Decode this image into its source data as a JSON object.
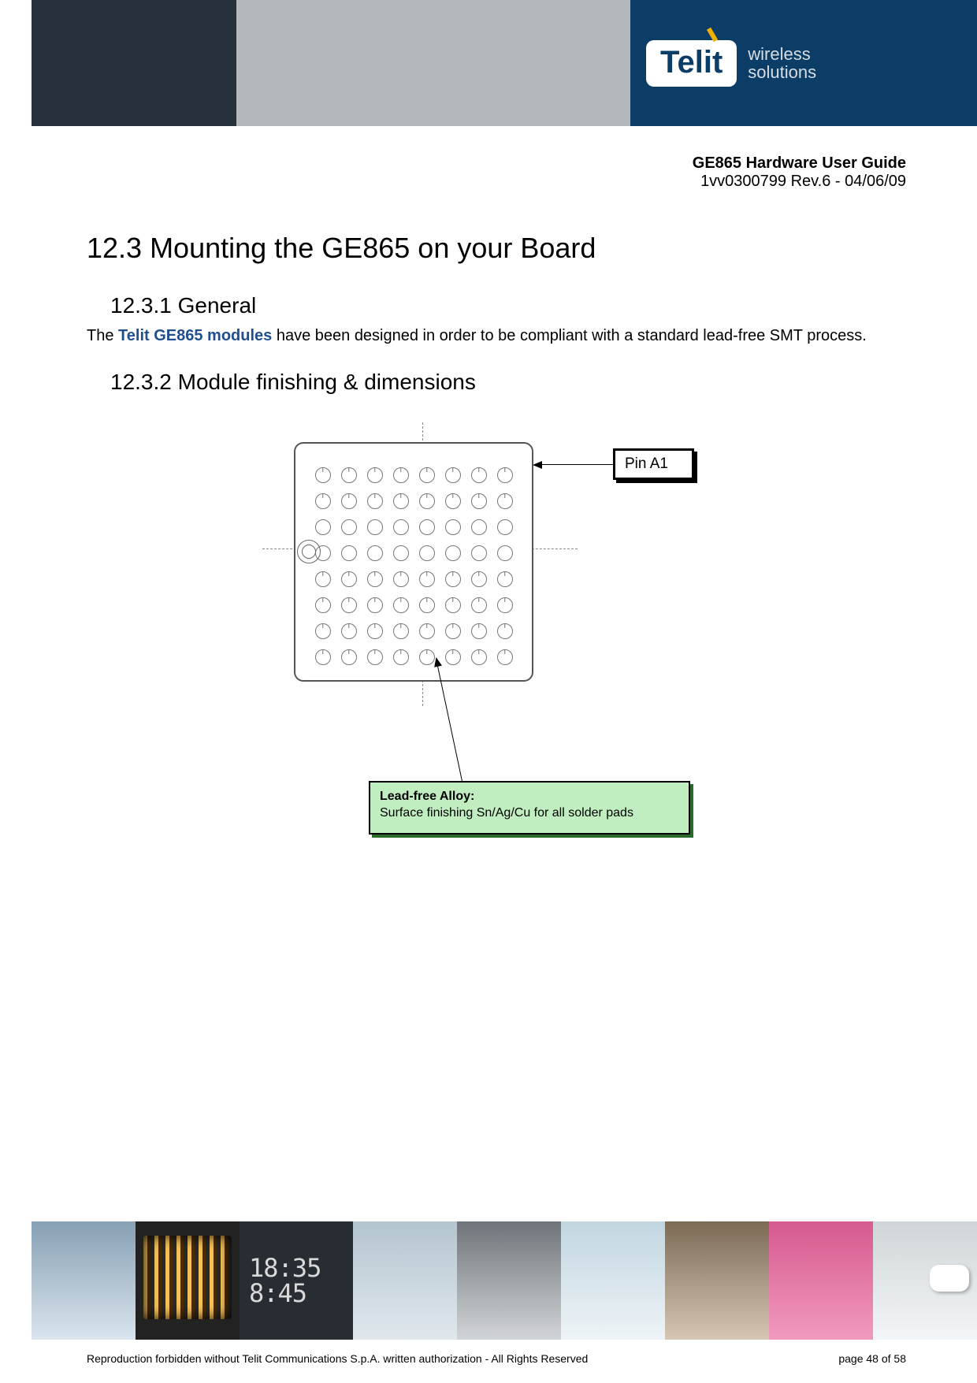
{
  "header": {
    "logo_text": "Telit",
    "logo_tag_line1": "wireless",
    "logo_tag_line2": "solutions"
  },
  "doc_header": {
    "title": "GE865 Hardware User Guide",
    "revision": "1vv0300799 Rev.6 - 04/06/09"
  },
  "section": {
    "number_title": "12.3 Mounting the GE865 on your Board",
    "sub1": {
      "heading": "12.3.1 General",
      "body_pre": "The ",
      "body_brand": "Telit GE865 modules",
      "body_post": " have been designed in order to be compliant with a standard lead-free SMT process."
    },
    "sub2": {
      "heading": "12.3.2 Module finishing & dimensions"
    }
  },
  "figure": {
    "pin_label": "Pin A1",
    "alloy_title": "Lead-free Alloy:",
    "alloy_text": "Surface finishing Sn/Ag/Cu for all solder pads",
    "pad_columns": 8,
    "pad_rows": 8,
    "pad_row_types": [
      "a",
      "a",
      "o",
      "o",
      "a",
      "a",
      "a",
      "a"
    ]
  },
  "footer": {
    "clock_top": "18:35",
    "clock_bot": "8:45",
    "copyright": "Reproduction forbidden without Telit Communications S.p.A. written authorization - All Rights Reserved",
    "page": "page 48 of 58"
  }
}
